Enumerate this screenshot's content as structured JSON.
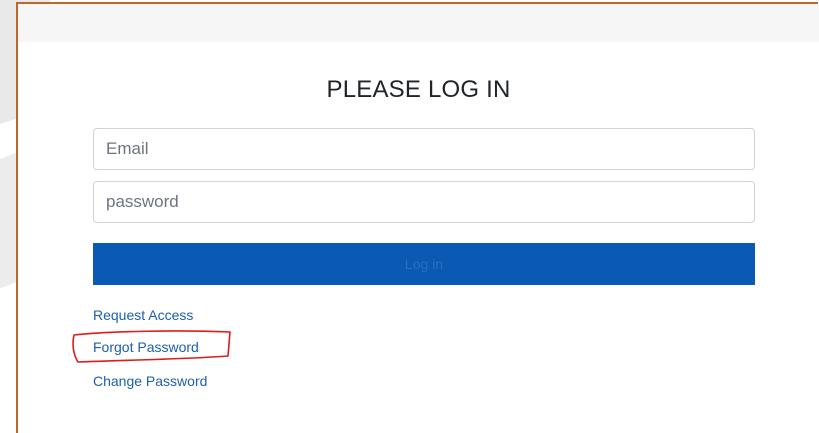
{
  "login_form": {
    "title": "PLEASE LOG IN",
    "email_placeholder": "Email",
    "password_placeholder": "password",
    "login_button_label": "Log in"
  },
  "links": {
    "request_access": "Request Access",
    "forgot_password": "Forgot Password",
    "change_password": "Change Password"
  },
  "colors": {
    "frame_border": "#c0662a",
    "login_button": "#0a59b2",
    "link": "#1d5fae",
    "annotation": "#e01b1b"
  }
}
